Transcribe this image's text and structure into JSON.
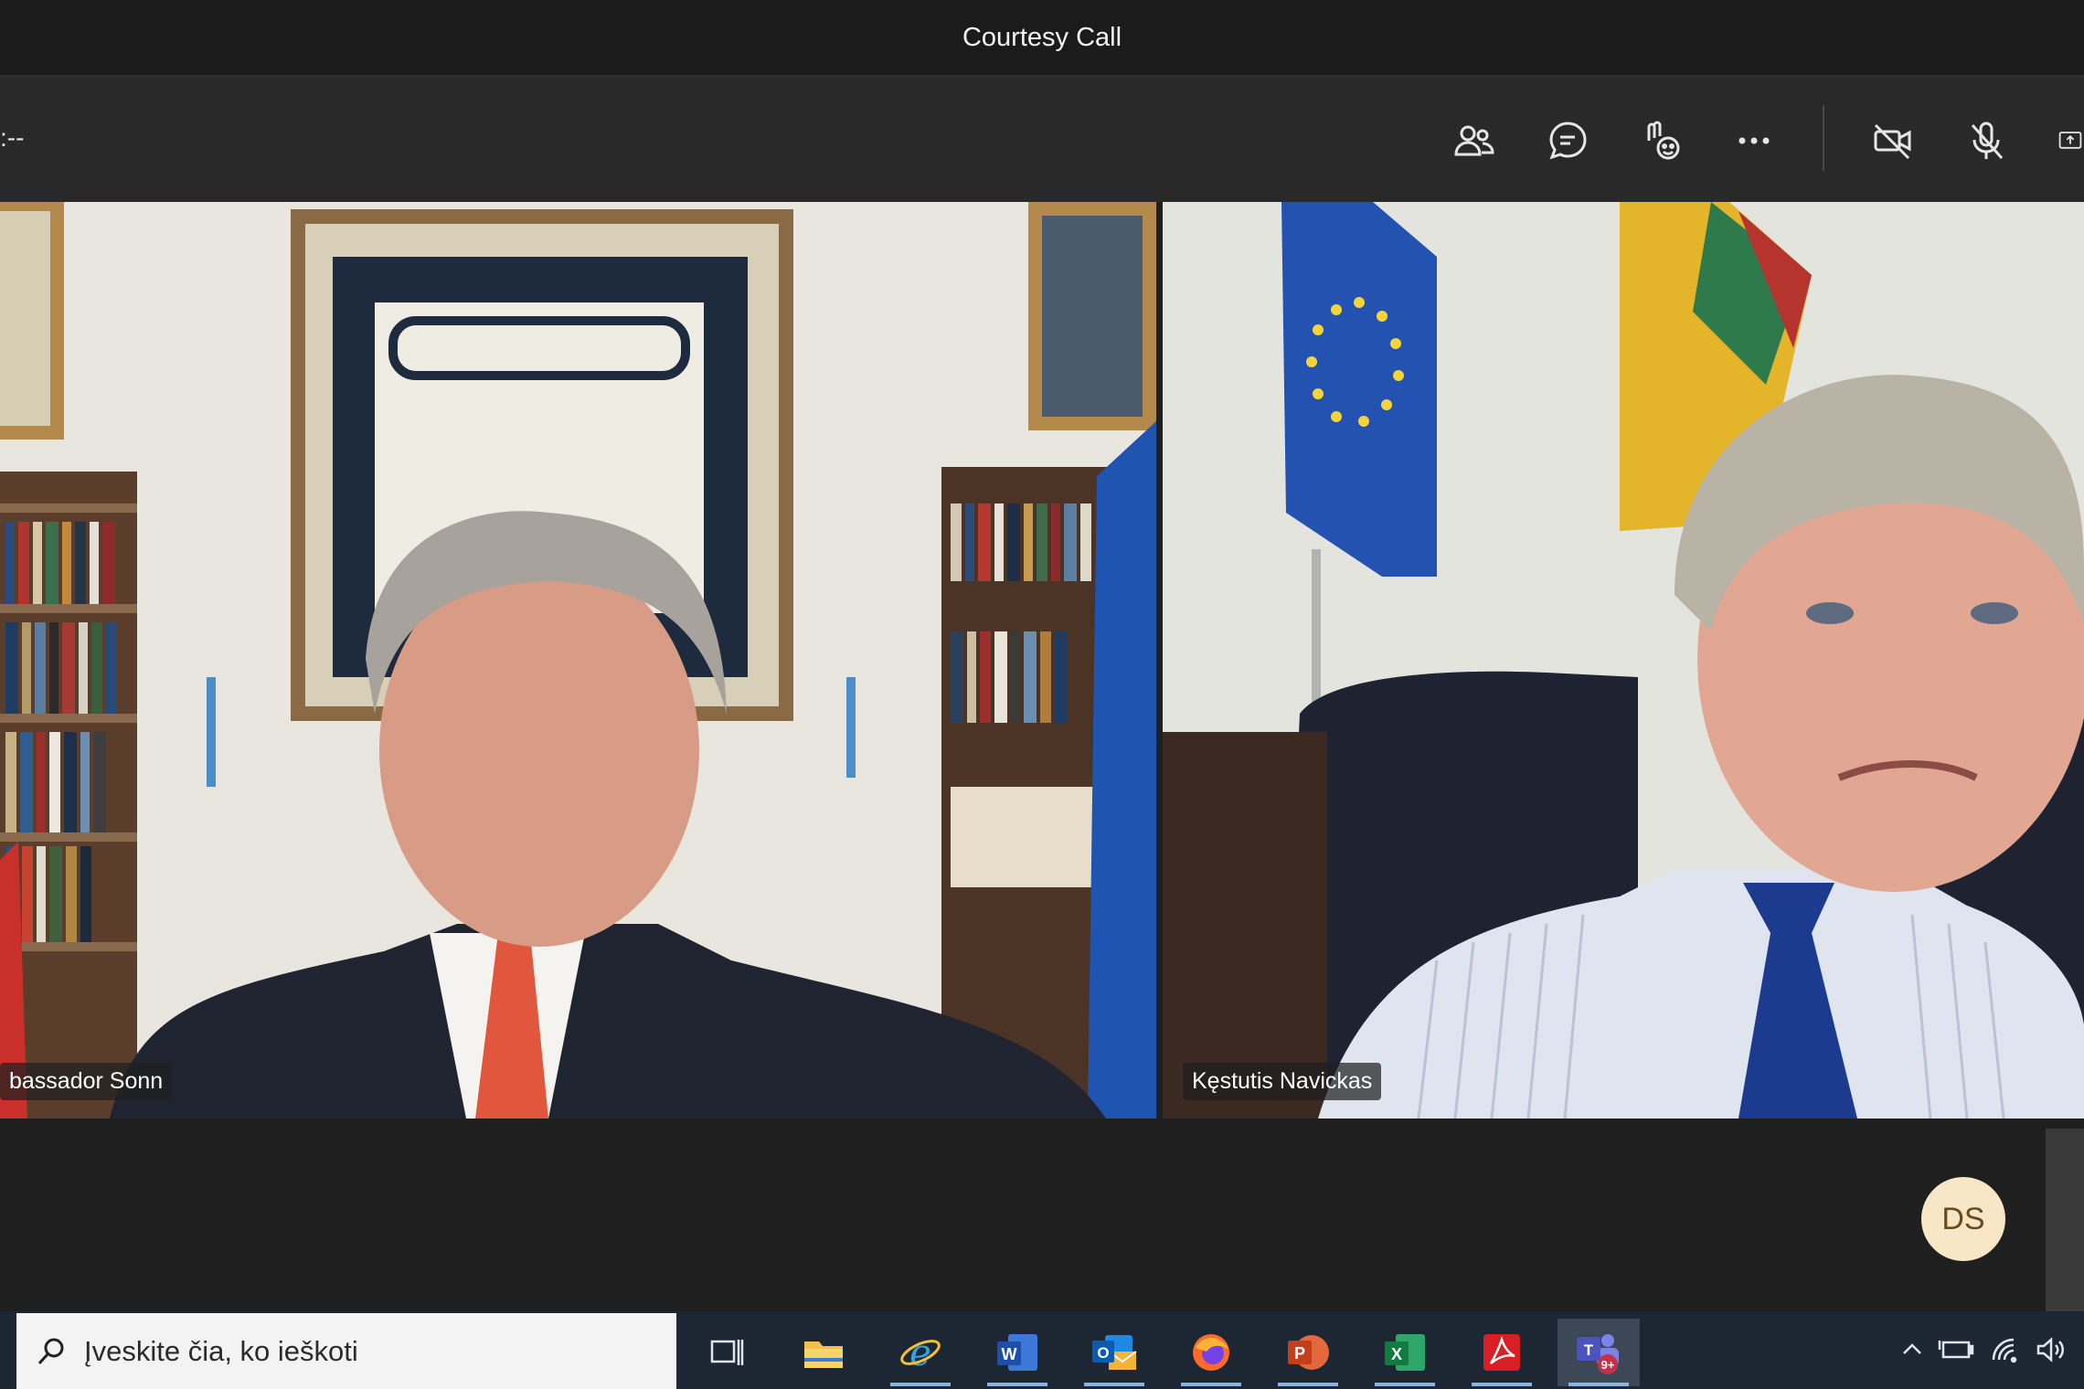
{
  "window": {
    "title": "Courtesy Call"
  },
  "toolbar": {
    "timer": ":--",
    "buttons": [
      "people-icon",
      "chat-icon",
      "reactions-icon",
      "more-icon",
      "camera-off-icon",
      "mic-off-icon",
      "share-icon"
    ]
  },
  "participants": [
    {
      "name": "bassador Sonn"
    },
    {
      "name": "Kęstutis Navickas"
    }
  ],
  "avatar": {
    "initials": "DS",
    "color": "#f7e7c7"
  },
  "taskbar": {
    "search_placeholder": "Įveskite čia, ko ieškoti",
    "apps": [
      "task-view",
      "file-explorer",
      "internet-explorer",
      "word",
      "outlook",
      "firefox",
      "powerpoint",
      "excel",
      "acrobat",
      "teams"
    ],
    "teams_badge": "9+"
  },
  "colors": {
    "accent": "#8ab4e8",
    "taskbar": "#1c2733",
    "toolbar": "#292929"
  }
}
